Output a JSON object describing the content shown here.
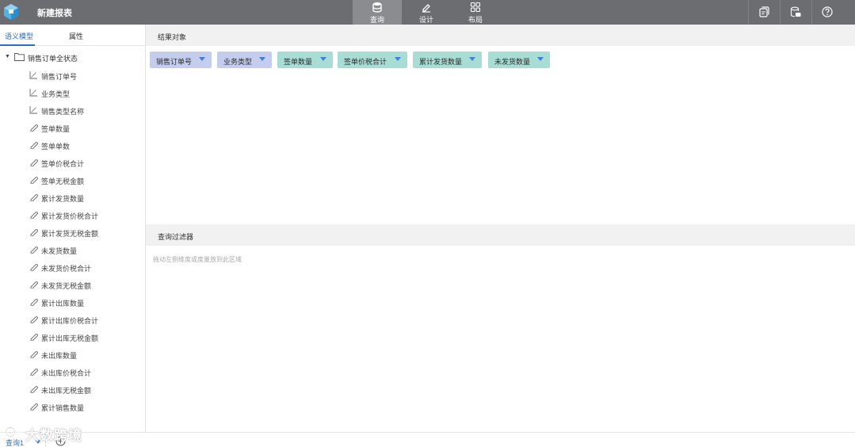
{
  "app": {
    "title": "新建报表"
  },
  "modes": [
    {
      "label": "查询",
      "icon": "database-icon",
      "active": true
    },
    {
      "label": "设计",
      "icon": "pencil-icon",
      "active": false
    },
    {
      "label": "布局",
      "icon": "grid-icon",
      "active": false
    }
  ],
  "toolbar": {
    "icons": [
      "copy-icon",
      "sql-icon",
      "help-icon"
    ]
  },
  "left_tabs": [
    {
      "label": "语义模型",
      "active": true
    },
    {
      "label": "属性",
      "active": false
    }
  ],
  "tree": {
    "root": "销售订单全状态",
    "dimensions": [
      "销售订单号",
      "业务类型",
      "销售类型名称"
    ],
    "measures": [
      "签单数量",
      "签单单数",
      "签单价税合计",
      "签单无税金额",
      "累计发货数量",
      "累计发货价税合计",
      "累计发货无税金额",
      "未发货数量",
      "未发货价税合计",
      "未发货无税金额",
      "累计出库数量",
      "累计出库价税合计",
      "累计出库无税金额",
      "未出库数量",
      "未出库价税合计",
      "未出库无税金额",
      "累计销售数量"
    ]
  },
  "result": {
    "header": "结果对象",
    "chips": [
      {
        "label": "销售订单号",
        "kind": "dimension"
      },
      {
        "label": "业务类型",
        "kind": "dimension"
      },
      {
        "label": "签单数量",
        "kind": "measure"
      },
      {
        "label": "签单价税合计",
        "kind": "measure"
      },
      {
        "label": "累计发货数量",
        "kind": "measure"
      },
      {
        "label": "未发货数量",
        "kind": "measure"
      }
    ]
  },
  "filter": {
    "header": "查询过滤器",
    "placeholder": "拖动左侧维度或度量放到此区域"
  },
  "bottom": {
    "query_tab": "查询1"
  },
  "watermark": "大数跨境",
  "colors": {
    "topbar": "#6b6d71",
    "accent": "#2a6fc9",
    "dimension_chip": "#c5cdee",
    "measure_chip": "#a8ddd6"
  }
}
